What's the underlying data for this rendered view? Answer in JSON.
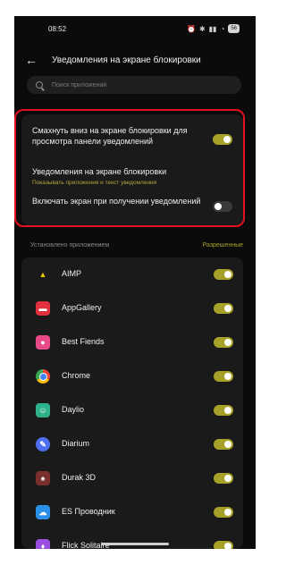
{
  "status": {
    "time": "08:52",
    "battery": "56"
  },
  "header": {
    "title": "Уведомления на экране блокировки"
  },
  "search": {
    "placeholder": "Поиск приложений"
  },
  "settings": [
    {
      "label": "Смахнуть вниз на экране блокировки для просмотра панели уведомлений",
      "sub": "",
      "toggle": "on"
    },
    {
      "label": "Уведомления на экране блокировки",
      "sub": "Показывать приложения и текст уведомления",
      "toggle": ""
    },
    {
      "label": "Включать экран при получении уведомлений",
      "sub": "",
      "toggle": "off"
    }
  ],
  "section": {
    "left": "Установлено приложением",
    "right": "Разрешенные"
  },
  "apps": [
    {
      "name": "AIMP",
      "icon": "aimp-icon",
      "color": "#f0c500",
      "enabled": true
    },
    {
      "name": "AppGallery",
      "icon": "appgallery-icon",
      "color": "#e0313d",
      "enabled": true
    },
    {
      "name": "Best Fiends",
      "icon": "bestfiends-icon",
      "color": "#e84a88",
      "enabled": true
    },
    {
      "name": "Chrome",
      "icon": "chrome-icon",
      "color": "#4285f4",
      "enabled": true
    },
    {
      "name": "Daylio",
      "icon": "daylio-icon",
      "color": "#2fb28b",
      "enabled": true
    },
    {
      "name": "Diarium",
      "icon": "diarium-icon",
      "color": "#4e6ff0",
      "enabled": true
    },
    {
      "name": "Durak 3D",
      "icon": "durak-icon",
      "color": "#7a2f2f",
      "enabled": true
    },
    {
      "name": "ES Проводник",
      "icon": "esexplorer-icon",
      "color": "#2a8fe8",
      "enabled": true
    },
    {
      "name": "Flick Solitaire",
      "icon": "flick-icon",
      "color": "#9b4de0",
      "enabled": true
    }
  ]
}
